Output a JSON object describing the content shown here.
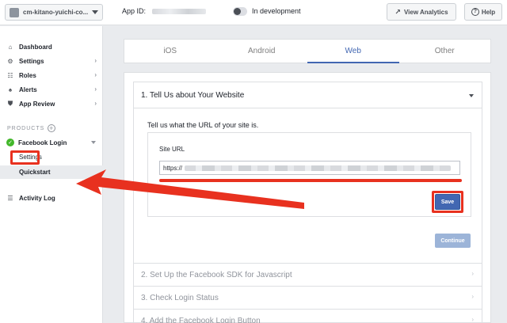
{
  "topbar": {
    "app_name": "cm-kitano-yuichi-co...",
    "app_id_label": "App ID:",
    "dev_status": "In development",
    "analytics_button": "View Analytics",
    "help_button": "Help"
  },
  "sidebar": {
    "items": [
      {
        "label": "Dashboard",
        "icon": "home-icon",
        "glyph": "⌂"
      },
      {
        "label": "Settings",
        "icon": "gear-icon",
        "glyph": "⚙"
      },
      {
        "label": "Roles",
        "icon": "roles-icon",
        "glyph": "☷"
      },
      {
        "label": "Alerts",
        "icon": "bell-icon",
        "glyph": "♠"
      },
      {
        "label": "App Review",
        "icon": "shield-icon",
        "glyph": "⛊"
      }
    ],
    "products_label": "PRODUCTS",
    "product_name": "Facebook Login",
    "sub_settings": "Settings",
    "sub_quickstart": "Quickstart",
    "activity_log": "Activity Log"
  },
  "tabs": [
    "iOS",
    "Android",
    "Web",
    "Other"
  ],
  "active_tab": "Web",
  "step1": {
    "title": "1. Tell Us about Your Website",
    "intro": "Tell us what the URL of your site is.",
    "url_label": "Site URL",
    "url_prefix": "https://",
    "save_button": "Save",
    "continue_button": "Continue"
  },
  "steps": [
    "2. Set Up the Facebook SDK for Javascript",
    "3. Check Login Status",
    "4. Add the Facebook Login Button"
  ],
  "colors": {
    "accent": "#4267b2",
    "annotation": "#e8311f",
    "success": "#42b72a"
  }
}
